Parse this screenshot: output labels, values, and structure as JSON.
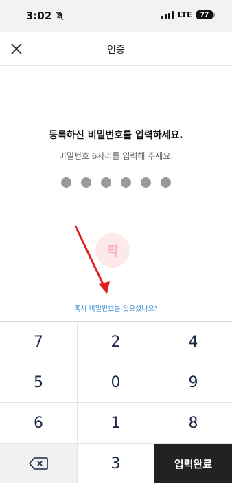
{
  "status_bar": {
    "time": "3:02",
    "network": "LTE",
    "battery": "77"
  },
  "header": {
    "title": "인증"
  },
  "prompt": {
    "title": "등록하신 비밀번호를 입력하세요.",
    "subtitle": "비밀번호 6자리를 입력해 주세요."
  },
  "pin": {
    "length": 6,
    "entered": 0
  },
  "watermark": {
    "text": "픽"
  },
  "forgot_link": "혹시 비밀번호를 잊으셨나요?",
  "keypad": {
    "rows": [
      [
        "7",
        "2",
        "4"
      ],
      [
        "5",
        "0",
        "9"
      ],
      [
        "6",
        "1",
        "8"
      ]
    ],
    "bottom_middle": "3",
    "complete_label": "입력완료"
  },
  "colors": {
    "accent_link": "#3a8fd8",
    "complete_button": "#222222",
    "dot": "#9a9a9a",
    "annotation_arrow": "#e02020"
  }
}
